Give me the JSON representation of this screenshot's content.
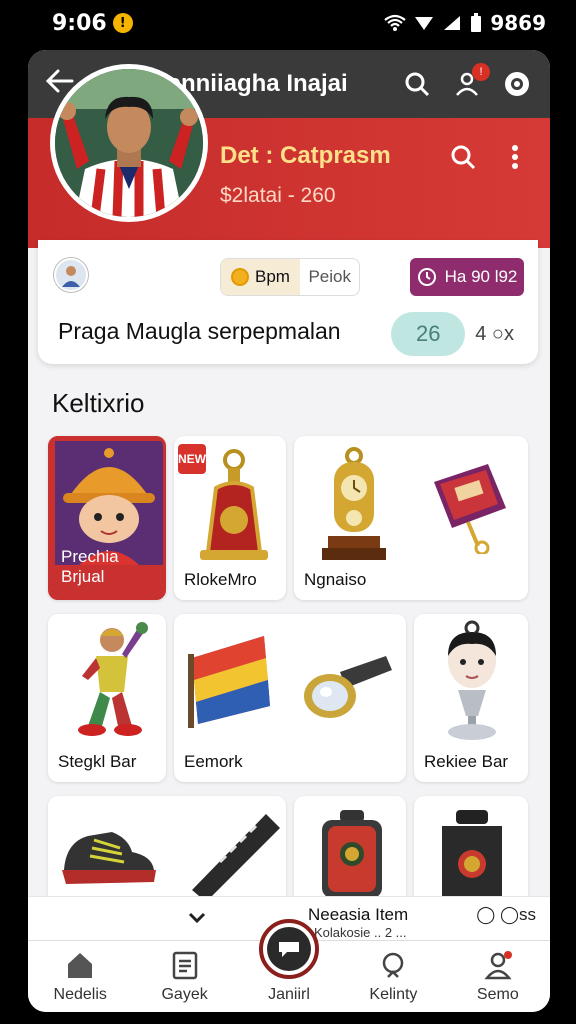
{
  "status": {
    "time": "9:06",
    "battery_text": "9869"
  },
  "appbar": {
    "title": "Nenniiagha Inajai"
  },
  "profile": {
    "name": "Det : Catprasm",
    "subtitle": "$2latai - 260",
    "currency_label": "Bpm",
    "currency_tab": "Peiok",
    "vip_label": "Ha 90 l92",
    "tagline": "Praga Maugla serpepmalan",
    "count": "26",
    "stat_suffix": "4  ○x"
  },
  "section": {
    "title": "Keltixrio"
  },
  "items": [
    {
      "label": "Prechia Brjual",
      "icon": "boy-avatar-icon"
    },
    {
      "label": "RlokeMro",
      "icon": "bell-charm-icon"
    },
    {
      "label": "Ngnaiso",
      "icon": "trophy-clock-icon"
    },
    {
      "label": "",
      "icon": "purple-badge-icon"
    },
    {
      "label": "Stegkl Bar",
      "icon": "dancer-figure-icon"
    },
    {
      "label": "Eemork",
      "icon": "flag-banner-icon"
    },
    {
      "label": "",
      "icon": "flashlight-icon"
    },
    {
      "label": "Rekiee Bar",
      "icon": "bust-trophy-icon"
    },
    {
      "label": "",
      "icon": "shoe-icon"
    },
    {
      "label": "",
      "icon": "scarf-icon"
    },
    {
      "label": "",
      "icon": "backpack-icon"
    },
    {
      "label": "",
      "icon": "jersey-icon"
    }
  ],
  "floatbar": {
    "primary": "Neeasia Item",
    "secondary": "Kolakosie .. 2 ...",
    "right": "◯ ◯ss"
  },
  "nav": [
    {
      "label": "Nedelis",
      "icon": "home-icon"
    },
    {
      "label": "Gayek",
      "icon": "clipboard-icon"
    },
    {
      "label": "Janiirl",
      "icon": "chat-icon"
    },
    {
      "label": "Kelinty",
      "icon": "search-icon"
    },
    {
      "label": "Semo",
      "icon": "profile-icon"
    }
  ],
  "colors": {
    "primary_red": "#c8312f",
    "appbar": "#3a3a3a",
    "vip": "#8e2c6e"
  }
}
